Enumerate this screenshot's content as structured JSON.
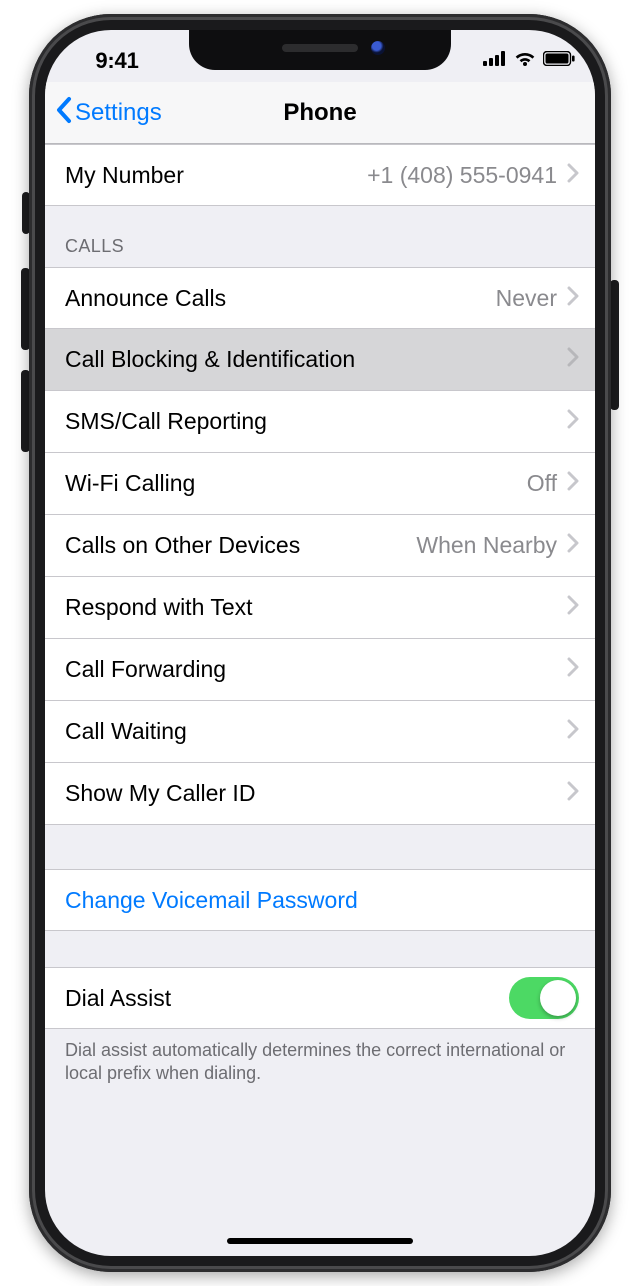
{
  "statusbar": {
    "time": "9:41"
  },
  "nav": {
    "back": "Settings",
    "title": "Phone"
  },
  "top_group": {
    "items": [
      {
        "label": "My Number",
        "value": "+1 (408) 555-0941"
      }
    ]
  },
  "calls_group": {
    "header": "CALLS",
    "items": [
      {
        "label": "Announce Calls",
        "value": "Never"
      },
      {
        "label": "Call Blocking & Identification",
        "value": ""
      },
      {
        "label": "SMS/Call Reporting",
        "value": ""
      },
      {
        "label": "Wi-Fi Calling",
        "value": "Off"
      },
      {
        "label": "Calls on Other Devices",
        "value": "When Nearby"
      },
      {
        "label": "Respond with Text",
        "value": ""
      },
      {
        "label": "Call Forwarding",
        "value": ""
      },
      {
        "label": "Call Waiting",
        "value": ""
      },
      {
        "label": "Show My Caller ID",
        "value": ""
      }
    ]
  },
  "voicemail_group": {
    "items": [
      {
        "label": "Change Voicemail Password"
      }
    ]
  },
  "dial_group": {
    "items": [
      {
        "label": "Dial Assist",
        "on": true
      }
    ],
    "footer": "Dial assist automatically determines the correct international or local prefix when dialing."
  }
}
